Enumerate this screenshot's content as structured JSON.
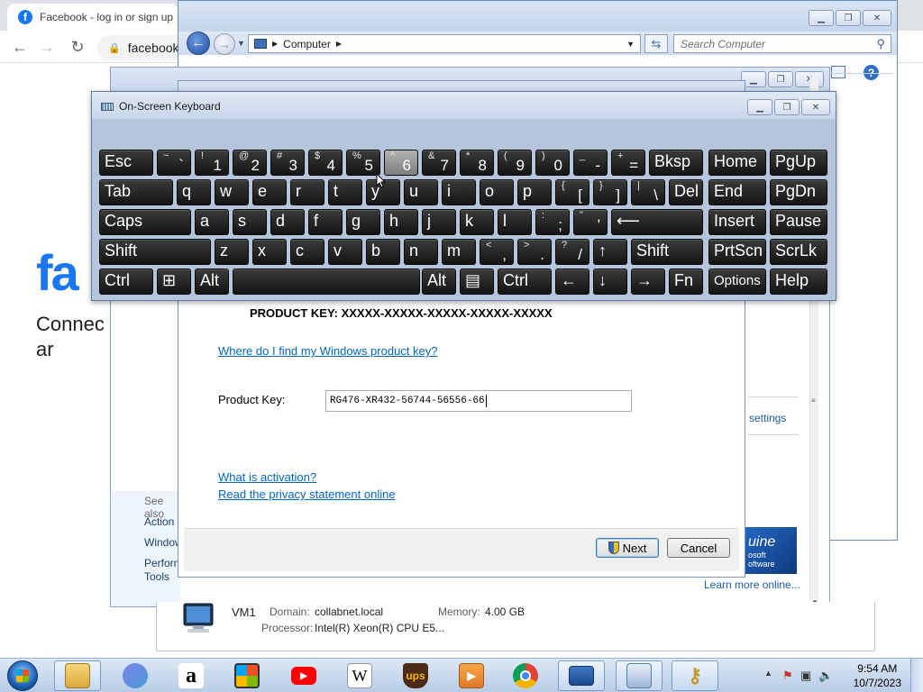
{
  "browser": {
    "tab_title": "Facebook - log in or sign up",
    "url": "facebook",
    "fb_logo": "fa",
    "fb_tagline": "Connec world ar"
  },
  "explorer": {
    "location": "Computer",
    "search_placeholder": "Search Computer"
  },
  "system_window": {
    "see_also": "See also",
    "action_center": "Action",
    "windows_update": "Window",
    "performance": "Perform",
    "tools": "Tools",
    "settings_link": "settings",
    "genuine_text": "uine",
    "genuine_sub1": "osoft",
    "genuine_sub2": "oftware",
    "learn_more": "Learn more online..."
  },
  "details": {
    "computer_name": "VM1",
    "domain_label": "Domain:",
    "domain_value": "collabnet.local",
    "memory_label": "Memory:",
    "memory_value": "4.00 GB",
    "processor_label": "Processor:",
    "processor_value": "Intel(R) Xeon(R) CPU E5..."
  },
  "activation": {
    "product_key_line": "PRODUCT KEY:  XXXXX-XXXXX-XXXXX-XXXXX-XXXXX",
    "where_link": "Where do I find my Windows product key?",
    "product_key_label": "Product Key:",
    "product_key_value": "RG476-XR432-56744-56556-66",
    "what_is_activation": "What is activation?",
    "privacy_link": "Read the privacy statement online",
    "next_label": "Next",
    "cancel_label": "Cancel"
  },
  "osk": {
    "title": "On-Screen Keyboard",
    "rows": [
      [
        {
          "id": "esc",
          "label": "Esc"
        },
        {
          "id": "grave",
          "top": "~",
          "bot": "`"
        },
        {
          "id": "1",
          "top": "!",
          "bot": "1"
        },
        {
          "id": "2",
          "top": "@",
          "bot": "2"
        },
        {
          "id": "3",
          "top": "#",
          "bot": "3"
        },
        {
          "id": "4",
          "top": "$",
          "bot": "4"
        },
        {
          "id": "5",
          "top": "%",
          "bot": "5"
        },
        {
          "id": "6",
          "top": "^",
          "bot": "6"
        },
        {
          "id": "7",
          "top": "&",
          "bot": "7"
        },
        {
          "id": "8",
          "top": "*",
          "bot": "8"
        },
        {
          "id": "9",
          "top": "(",
          "bot": "9"
        },
        {
          "id": "0",
          "top": ")",
          "bot": "0"
        },
        {
          "id": "minus",
          "top": "_",
          "bot": "-"
        },
        {
          "id": "equals",
          "top": "+",
          "bot": "="
        },
        {
          "id": "bksp",
          "label": "Bksp"
        },
        {
          "id": "home",
          "label": "Home"
        },
        {
          "id": "pgup",
          "label": "PgUp"
        }
      ],
      [
        {
          "id": "tab",
          "label": "Tab"
        },
        {
          "id": "q",
          "label": "q"
        },
        {
          "id": "w",
          "label": "w"
        },
        {
          "id": "e",
          "label": "e"
        },
        {
          "id": "r",
          "label": "r"
        },
        {
          "id": "t",
          "label": "t"
        },
        {
          "id": "y",
          "label": "y"
        },
        {
          "id": "u",
          "label": "u"
        },
        {
          "id": "i",
          "label": "i"
        },
        {
          "id": "o",
          "label": "o"
        },
        {
          "id": "p",
          "label": "p"
        },
        {
          "id": "lbracket",
          "top": "{",
          "bot": "["
        },
        {
          "id": "rbracket",
          "top": "}",
          "bot": "]"
        },
        {
          "id": "backslash",
          "top": "|",
          "bot": "\\"
        },
        {
          "id": "del",
          "label": "Del"
        },
        {
          "id": "end",
          "label": "End"
        },
        {
          "id": "pgdn",
          "label": "PgDn"
        }
      ],
      [
        {
          "id": "caps",
          "label": "Caps"
        },
        {
          "id": "a",
          "label": "a"
        },
        {
          "id": "s",
          "label": "s"
        },
        {
          "id": "d",
          "label": "d"
        },
        {
          "id": "f",
          "label": "f"
        },
        {
          "id": "g",
          "label": "g"
        },
        {
          "id": "h",
          "label": "h"
        },
        {
          "id": "j",
          "label": "j"
        },
        {
          "id": "k",
          "label": "k"
        },
        {
          "id": "l",
          "label": "l"
        },
        {
          "id": "semicolon",
          "top": ":",
          "bot": ";"
        },
        {
          "id": "quote",
          "top": "\"",
          "bot": "'"
        },
        {
          "id": "enter",
          "label": "⟵"
        },
        {
          "id": "insert",
          "label": "Insert"
        },
        {
          "id": "pause",
          "label": "Pause"
        }
      ],
      [
        {
          "id": "lshift",
          "label": "Shift"
        },
        {
          "id": "z",
          "label": "z"
        },
        {
          "id": "x",
          "label": "x"
        },
        {
          "id": "c",
          "label": "c"
        },
        {
          "id": "v",
          "label": "v"
        },
        {
          "id": "b",
          "label": "b"
        },
        {
          "id": "n",
          "label": "n"
        },
        {
          "id": "m",
          "label": "m"
        },
        {
          "id": "comma",
          "top": "<",
          "bot": ","
        },
        {
          "id": "period",
          "top": ">",
          "bot": "."
        },
        {
          "id": "slash",
          "top": "?",
          "bot": "/"
        },
        {
          "id": "up",
          "label": "↑"
        },
        {
          "id": "rshift",
          "label": "Shift"
        },
        {
          "id": "prtscn",
          "label": "PrtScn"
        },
        {
          "id": "scrlk",
          "label": "ScrLk"
        }
      ],
      [
        {
          "id": "lctrl",
          "label": "Ctrl"
        },
        {
          "id": "win",
          "label": "⊞"
        },
        {
          "id": "lalt",
          "label": "Alt"
        },
        {
          "id": "space",
          "label": ""
        },
        {
          "id": "ralt",
          "label": "Alt"
        },
        {
          "id": "menu",
          "label": "▤"
        },
        {
          "id": "rctrl",
          "label": "Ctrl"
        },
        {
          "id": "left",
          "label": "←"
        },
        {
          "id": "down",
          "label": "↓"
        },
        {
          "id": "right",
          "label": "→"
        },
        {
          "id": "fn",
          "label": "Fn"
        },
        {
          "id": "options",
          "label": "Options"
        },
        {
          "id": "help",
          "label": "Help"
        }
      ]
    ]
  },
  "taskbar": {
    "items": [
      "file-explorer",
      "teams",
      "amazon",
      "store",
      "youtube",
      "wikipedia",
      "ups",
      "media-player",
      "chrome",
      "remote-desktop",
      "control-panel",
      "keys"
    ],
    "wikipedia_glyph": "W",
    "ups_glyph": "ups",
    "amazon_glyph": "a",
    "time": "9:54 AM",
    "date": "10/7/2023"
  },
  "colors": {
    "link": "#0066cc",
    "fb_blue": "#1877f2",
    "key_bg": "#1f1f1f",
    "osk_bg": "#b5c5dc"
  }
}
